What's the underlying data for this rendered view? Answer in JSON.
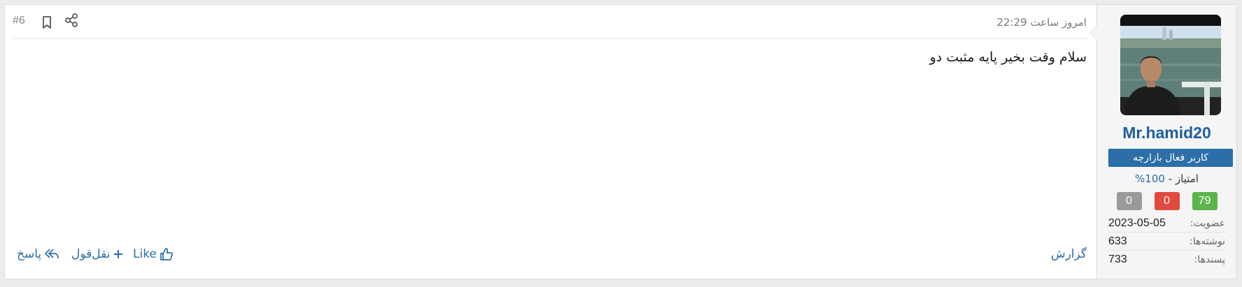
{
  "post": {
    "number": "#6",
    "timestamp": "امروز ساعت 22:29",
    "message": "سلام وقت بخیر پایه مثبت دو"
  },
  "actions": {
    "report": "گزارش",
    "like": "Like",
    "quote": "نقل‌قول",
    "reply": "پاسخ"
  },
  "user": {
    "username": "Mr.hamid20",
    "title": "کاربر فعال بازارچه",
    "rating_label": "امتیاز -",
    "rating_value": "100%",
    "badges": {
      "positive": "79",
      "negative": "0",
      "neutral": "0"
    },
    "stats": [
      {
        "label": "عضویت:",
        "value": "2023-05-05"
      },
      {
        "label": "نوشته‌ها:",
        "value": "633"
      },
      {
        "label": "پسندها:",
        "value": "733"
      }
    ]
  },
  "icons": {
    "share": "share-icon",
    "bookmark": "bookmark-icon",
    "like": "thumbs-up-icon",
    "quote": "plus-icon",
    "reply": "reply-icon"
  },
  "colors": {
    "link": "#2b6ea8",
    "username": "#1f5f9f",
    "user_title_bg": "#2b6ea8",
    "badge_positive": "#5cb54a",
    "badge_negative": "#e04a3f",
    "badge_neutral": "#9a9a9a"
  }
}
